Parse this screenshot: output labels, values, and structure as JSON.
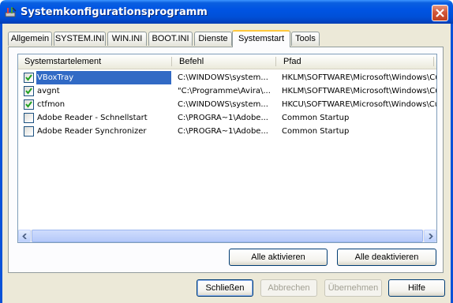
{
  "window": {
    "title": "Systemkonfigurationsprogramm"
  },
  "tabs": [
    {
      "label": "Allgemein"
    },
    {
      "label": "SYSTEM.INI"
    },
    {
      "label": "WIN.INI"
    },
    {
      "label": "BOOT.INI"
    },
    {
      "label": "Dienste"
    },
    {
      "label": "Systemstart",
      "active": true
    },
    {
      "label": "Tools"
    }
  ],
  "startup_list": {
    "columns": [
      "Systemstartelement",
      "Befehl",
      "Pfad"
    ],
    "rows": [
      {
        "checked": true,
        "name": "VBoxTray",
        "command": "C:\\WINDOWS\\system...",
        "path": "HKLM\\SOFTWARE\\Microsoft\\Windows\\Cu",
        "selected": true
      },
      {
        "checked": true,
        "name": "avgnt",
        "command": "\"C:\\Programme\\Avira\\...",
        "path": "HKLM\\SOFTWARE\\Microsoft\\Windows\\Cu"
      },
      {
        "checked": true,
        "name": "ctfmon",
        "command": "C:\\WINDOWS\\system...",
        "path": "HKCU\\SOFTWARE\\Microsoft\\Windows\\Cu"
      },
      {
        "checked": false,
        "name": "Adobe Reader - Schnellstart",
        "command": "C:\\PROGRA~1\\Adobe...",
        "path": "Common Startup"
      },
      {
        "checked": false,
        "name": "Adobe Reader Synchronizer",
        "command": "C:\\PROGRA~1\\Adobe...",
        "path": "Common Startup"
      }
    ]
  },
  "panel_buttons": {
    "enable_all": "Alle aktivieren",
    "disable_all": "Alle deaktivieren"
  },
  "dialog_buttons": {
    "close": "Schließen",
    "cancel": "Abbrechen",
    "apply": "Übernehmen",
    "help": "Hilfe"
  },
  "colors": {
    "titlebar": "#0054e3",
    "selection": "#316ac5",
    "dialog_bg": "#ece9d8",
    "active_tab_accent": "#ffc83c"
  }
}
